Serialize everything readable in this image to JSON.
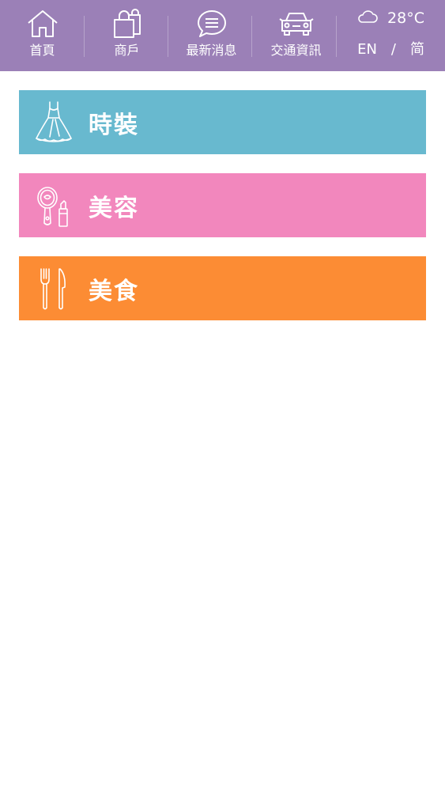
{
  "colors": {
    "header_bg": "#9b80b7",
    "fashion": "#68b9cf",
    "beauty": "#f287bd",
    "food": "#fc8c34"
  },
  "nav": {
    "items": [
      {
        "label": "首頁",
        "icon": "home-icon"
      },
      {
        "label": "商戶",
        "icon": "shopping-bag-icon"
      },
      {
        "label": "最新消息",
        "icon": "chat-icon"
      },
      {
        "label": "交通資訊",
        "icon": "car-icon"
      }
    ]
  },
  "weather": {
    "temperature": "28°C",
    "icon": "cloud-icon"
  },
  "language": {
    "en": "EN",
    "separator": "/",
    "simplified": "简"
  },
  "categories": [
    {
      "label": "時裝",
      "icon": "dress-icon"
    },
    {
      "label": "美容",
      "icon": "mirror-lipstick-icon"
    },
    {
      "label": "美食",
      "icon": "fork-knife-icon"
    }
  ]
}
